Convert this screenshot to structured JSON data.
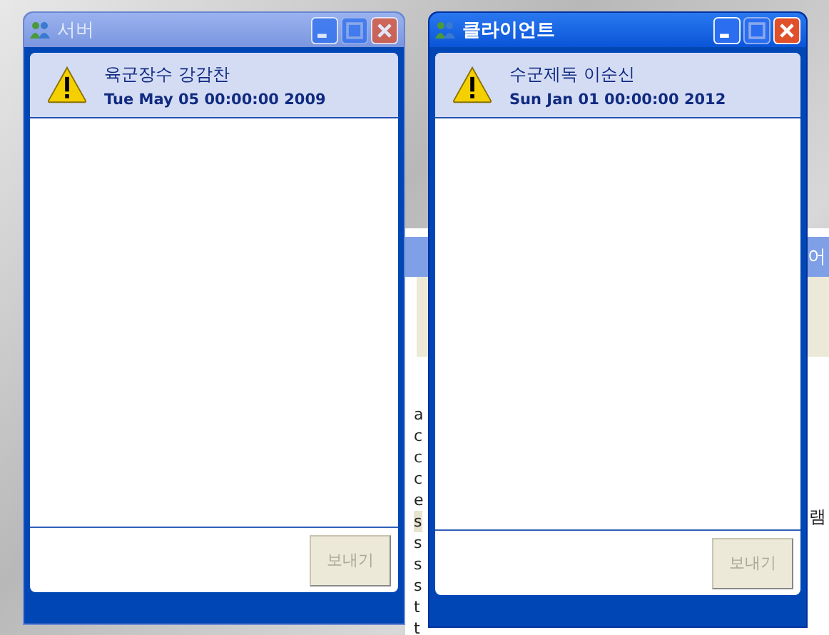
{
  "background_window": {
    "title_right": "어",
    "list_items": [
      {
        "text": "a",
        "selected": false
      },
      {
        "text": "c",
        "selected": false
      },
      {
        "text": "c",
        "selected": false
      },
      {
        "text": "c",
        "selected": false
      },
      {
        "text": "e",
        "selected": false
      },
      {
        "text": "s",
        "selected": true
      },
      {
        "text": "s",
        "selected": false
      },
      {
        "text": "s",
        "selected": false
      },
      {
        "text": "s",
        "selected": false
      },
      {
        "text": "t",
        "selected": false
      },
      {
        "text": "t",
        "selected": false
      }
    ],
    "side_text": "램"
  },
  "windows": [
    {
      "title": "서버",
      "active": false,
      "name": "육군장수 강감찬",
      "date": "Tue May 05 00:00:00 2009",
      "send_button": {
        "label": "보내기",
        "disabled": true
      }
    },
    {
      "title": "클라이언트",
      "active": true,
      "name": "수군제독 이순신",
      "date": "Sun Jan 01 00:00:00 2012",
      "send_button": {
        "label": "보내기",
        "disabled": true
      }
    }
  ]
}
